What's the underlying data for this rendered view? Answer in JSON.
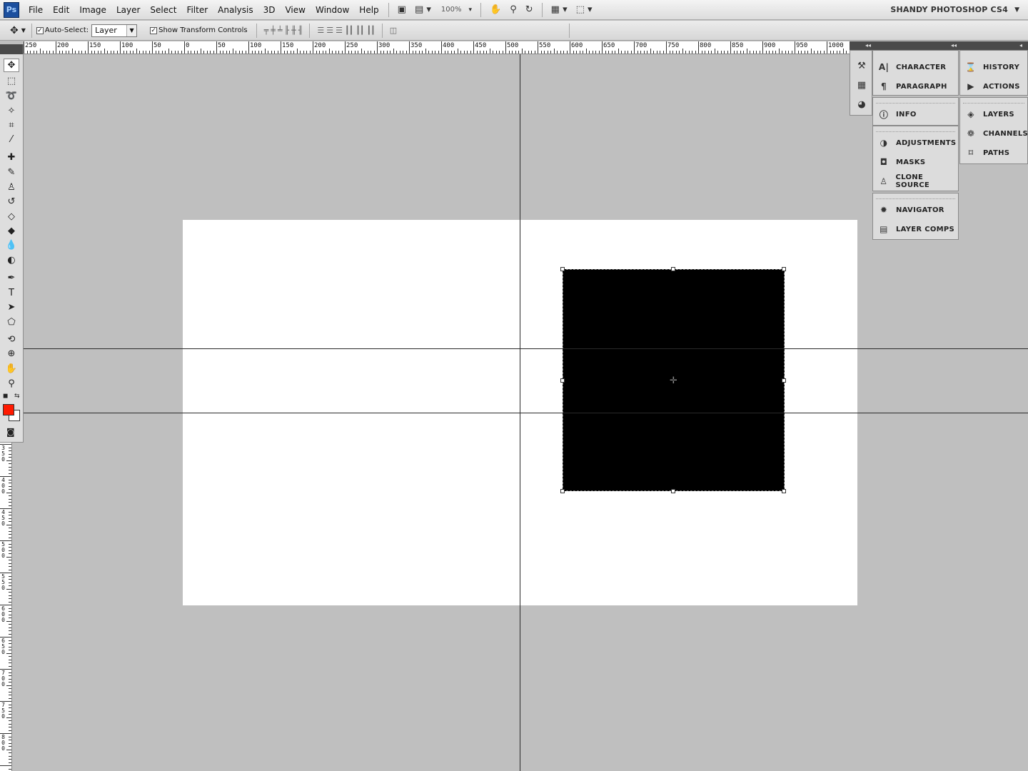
{
  "app": {
    "logo": "Ps",
    "workspace_name": "SHANDY PHOTOSHOP CS4",
    "zoom_level": "100%"
  },
  "menubar": {
    "items": [
      "File",
      "Edit",
      "Image",
      "Layer",
      "Select",
      "Filter",
      "Analysis",
      "3D",
      "View",
      "Window",
      "Help"
    ]
  },
  "options": {
    "auto_select_label": "Auto-Select:",
    "auto_select_checked": true,
    "layer_select_value": "Layer",
    "show_transform_label": "Show Transform Controls",
    "show_transform_checked": true
  },
  "ruler": {
    "h_labels": [
      "250",
      "200",
      "150",
      "100",
      "50",
      "0",
      "50",
      "100",
      "150",
      "200",
      "250",
      "300",
      "350",
      "400",
      "450",
      "500",
      "550",
      "600",
      "650",
      "700",
      "750",
      "800",
      "850",
      "900",
      "950",
      "1000"
    ],
    "v_labels": [
      "350",
      "400",
      "450",
      "500",
      "550",
      "600",
      "650",
      "700",
      "750",
      "800"
    ]
  },
  "colors": {
    "foreground": "#ff1a00",
    "background": "#ffffff",
    "shape_fill": "#000000"
  },
  "panels": {
    "group1": [
      {
        "label": "CHARACTER",
        "icon": "character-icon"
      },
      {
        "label": "PARAGRAPH",
        "icon": "paragraph-icon"
      }
    ],
    "group2": [
      {
        "label": "INFO",
        "icon": "info-icon"
      }
    ],
    "group3": [
      {
        "label": "ADJUSTMENTS",
        "icon": "adjustments-icon"
      },
      {
        "label": "MASKS",
        "icon": "masks-icon"
      },
      {
        "label": "CLONE SOURCE",
        "icon": "clone-source-icon"
      }
    ],
    "group4": [
      {
        "label": "NAVIGATOR",
        "icon": "navigator-icon"
      },
      {
        "label": "LAYER COMPS",
        "icon": "layer-comps-icon"
      }
    ],
    "group5": [
      {
        "label": "HISTORY",
        "icon": "history-icon"
      },
      {
        "label": "ACTIONS",
        "icon": "actions-icon"
      }
    ],
    "group6": [
      {
        "label": "LAYERS",
        "icon": "layers-icon"
      },
      {
        "label": "CHANNELS",
        "icon": "channels-icon"
      },
      {
        "label": "PATHS",
        "icon": "paths-icon"
      }
    ]
  }
}
